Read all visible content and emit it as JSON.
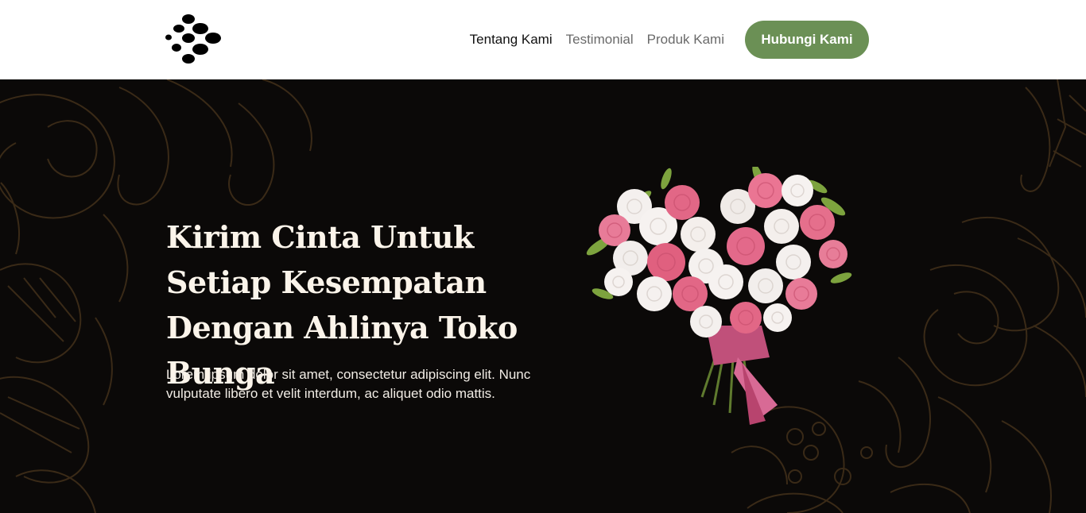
{
  "nav": {
    "logo_icon": "dots-logo-icon",
    "links": [
      {
        "label": "Tentang Kami",
        "active": true
      },
      {
        "label": "Testimonial",
        "active": false
      },
      {
        "label": "Produk Kami",
        "active": false
      }
    ],
    "cta_label": "Hubungi Kami"
  },
  "hero": {
    "title": "Kirim Cinta Untuk Setiap Kesempatan Dengan Ahlinya Toko Bunga",
    "description": "Lorem ipsum dolor sit amet, consectetur adipiscing elit. Nunc vulputate libero et velit interdum, ac aliquet odio mattis.",
    "image_icon": "flower-bouquet-image",
    "background_icon": "floral-line-art-pattern"
  },
  "colors": {
    "accent": "#6b9055",
    "hero_bg": "#0b0908",
    "hero_text": "#fbf4ea",
    "pattern": "#3a2a17"
  }
}
